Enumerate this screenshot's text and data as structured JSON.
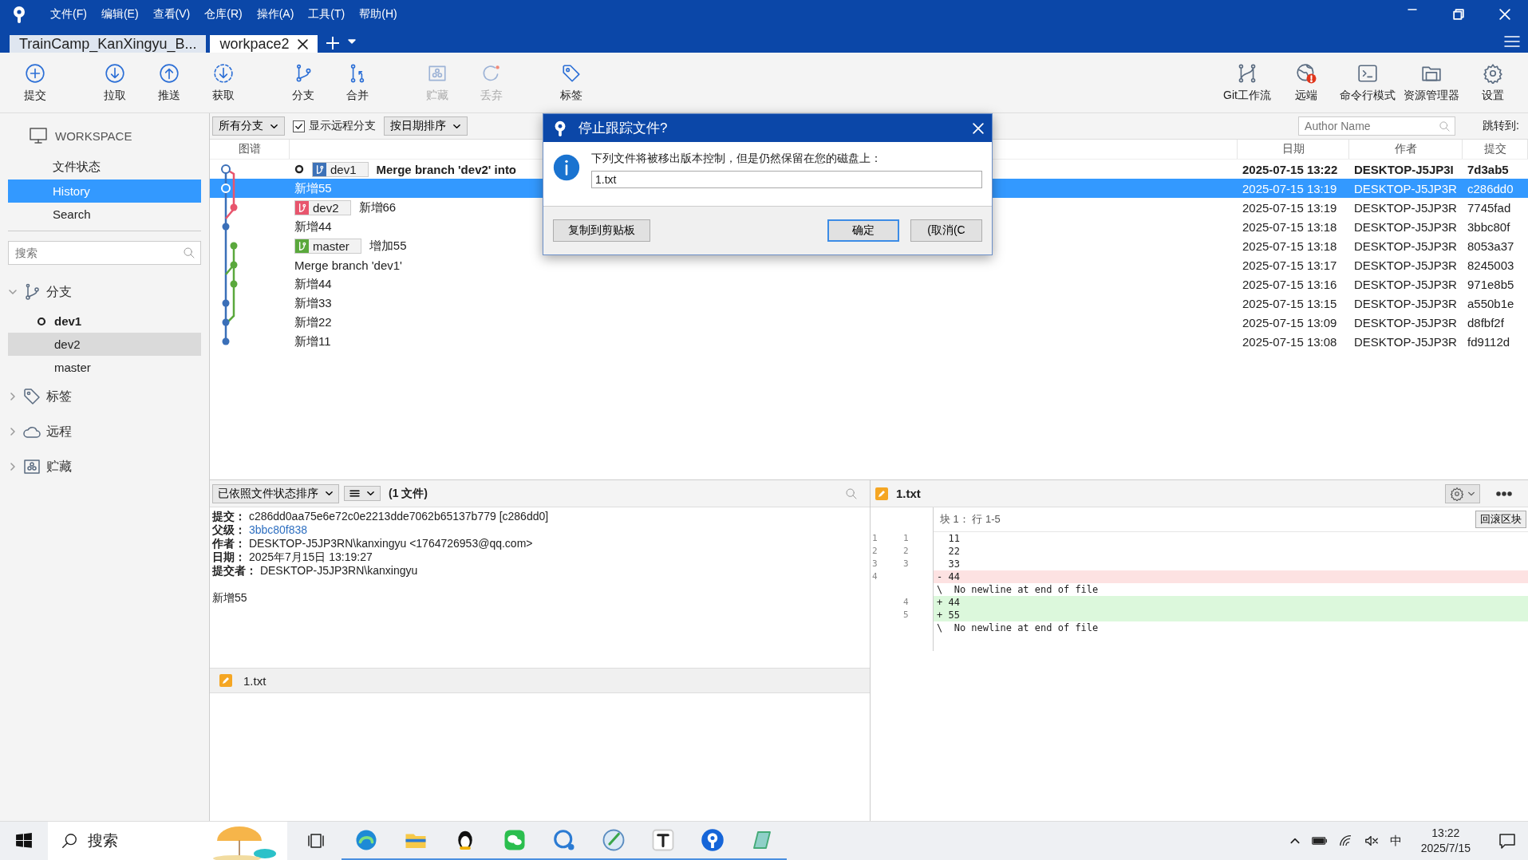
{
  "menu": [
    "文件(F)",
    "编辑(E)",
    "查看(V)",
    "仓库(R)",
    "操作(A)",
    "工具(T)",
    "帮助(H)"
  ],
  "tabs": [
    {
      "label": "TrainCamp_KanXingyu_B...",
      "selected": false
    },
    {
      "label": "workpace2",
      "selected": true
    }
  ],
  "toolbar": {
    "left": [
      {
        "label": "提交",
        "disabled": false
      },
      {
        "label": "拉取",
        "disabled": false
      },
      {
        "label": "推送",
        "disabled": false
      },
      {
        "label": "获取",
        "disabled": false
      },
      {
        "label": "分支",
        "disabled": false
      },
      {
        "label": "合并",
        "disabled": false
      },
      {
        "label": "贮藏",
        "disabled": true
      },
      {
        "label": "丢弃",
        "disabled": true
      },
      {
        "label": "标签",
        "disabled": false
      }
    ],
    "right": [
      {
        "label": "Git工作流",
        "disabled": false
      },
      {
        "label": "远端",
        "disabled": false
      },
      {
        "label": "命令行模式",
        "disabled": false
      },
      {
        "label": "资源管理器",
        "disabled": false
      },
      {
        "label": "设置",
        "disabled": false
      }
    ]
  },
  "sidebar": {
    "workspace": "WORKSPACE",
    "views": [
      {
        "label": "文件状态",
        "selected": false
      },
      {
        "label": "History",
        "selected": true
      },
      {
        "label": "Search",
        "selected": false
      }
    ],
    "search": {
      "placeholder": "搜索"
    },
    "sections": [
      {
        "label": "分支",
        "expanded": true,
        "children": [
          {
            "label": "dev1",
            "current": true,
            "selected": false
          },
          {
            "label": "dev2",
            "current": false,
            "selected": true
          },
          {
            "label": "master",
            "current": false,
            "selected": false
          }
        ]
      },
      {
        "label": "标签",
        "expanded": false
      },
      {
        "label": "远程",
        "expanded": false
      },
      {
        "label": "贮藏",
        "expanded": false
      }
    ]
  },
  "history": {
    "branch_filter": "所有分支",
    "show_remote": {
      "label": "显示远程分支",
      "checked": true
    },
    "sort": "按日期排序",
    "author": {
      "placeholder": "Author Name"
    },
    "jump_label": "跳转到:",
    "columns": [
      "图谱",
      "日期",
      "作者",
      "提交"
    ],
    "rows": [
      {
        "head": true,
        "badge": {
          "label": "dev1",
          "color": "#3d72b8"
        },
        "description": "Merge branch 'dev2' into",
        "date": "2025-07-15 13:22",
        "author": "DESKTOP-J5JP3I",
        "commit": "7d3ab5",
        "bold": true,
        "selected": false
      },
      {
        "head": false,
        "description": "新增55",
        "date": "2025-07-15 13:19",
        "author": "DESKTOP-J5JP3R",
        "commit": "c286dd0",
        "bold": false,
        "selected": true
      },
      {
        "head": false,
        "badge": {
          "label": "dev2",
          "color": "#e8556d"
        },
        "description": "新增66",
        "date": "2025-07-15 13:19",
        "author": "DESKTOP-J5JP3R",
        "commit": "7745fad",
        "bold": false,
        "selected": false
      },
      {
        "head": false,
        "description": "新增44",
        "date": "2025-07-15 13:18",
        "author": "DESKTOP-J5JP3R",
        "commit": "3bbc80f",
        "bold": false,
        "selected": false
      },
      {
        "head": false,
        "badge": {
          "label": "master",
          "color": "#5aa83c"
        },
        "description": "增加55",
        "date": "2025-07-15 13:18",
        "author": "DESKTOP-J5JP3R",
        "commit": "8053a37",
        "bold": false,
        "selected": false
      },
      {
        "head": false,
        "description": "Merge branch 'dev1'",
        "date": "2025-07-15 13:17",
        "author": "DESKTOP-J5JP3R",
        "commit": "8245003",
        "bold": false,
        "selected": false
      },
      {
        "head": false,
        "description": "新增44",
        "date": "2025-07-15 13:16",
        "author": "DESKTOP-J5JP3R",
        "commit": "971e8b5",
        "bold": false,
        "selected": false
      },
      {
        "head": false,
        "description": "新增33",
        "date": "2025-07-15 13:15",
        "author": "DESKTOP-J5JP3R",
        "commit": "a550b1e",
        "bold": false,
        "selected": false
      },
      {
        "head": false,
        "description": "新增22",
        "date": "2025-07-15 13:09",
        "author": "DESKTOP-J5JP3R",
        "commit": "d8fbf2f",
        "bold": false,
        "selected": false
      },
      {
        "head": false,
        "description": "新增11",
        "date": "2025-07-15 13:08",
        "author": "DESKTOP-J5JP3R",
        "commit": "fd9112d",
        "bold": false,
        "selected": false
      }
    ]
  },
  "details": {
    "sort": "已依照文件状态排序",
    "count": "(1 文件)",
    "fields": [
      {
        "label": "提交：",
        "value": "c286dd0aa75e6e72c0e2213dde7062b65137b779 [c286dd0]",
        "kind": "text"
      },
      {
        "label": "父级：",
        "value": "3bbc80f838",
        "kind": "link"
      },
      {
        "label": "作者：",
        "value": "DESKTOP-J5JP3RN\\kanxingyu <1764726953@qq.com>",
        "kind": "text"
      },
      {
        "label": "日期：",
        "value": "2025年7月15日 13:19:27",
        "kind": "text"
      },
      {
        "label": "提交者：",
        "value": "DESKTOP-J5JP3RN\\kanxingyu",
        "kind": "text"
      }
    ],
    "message": "新增55",
    "files": [
      "1.txt"
    ]
  },
  "diff": {
    "file": "1.txt",
    "hunk": "块 1： 行 1-5",
    "revert": "回滚区块",
    "lines": [
      {
        "old": "1",
        "new": "1",
        "kind": "context",
        "text": "  11"
      },
      {
        "old": "2",
        "new": "2",
        "kind": "context",
        "text": "  22"
      },
      {
        "old": "3",
        "new": "3",
        "kind": "context",
        "text": "  33"
      },
      {
        "old": "4",
        "kind": "removed",
        "text": "- 44"
      },
      {
        "kind": "context",
        "text": "\\  No newline at end of file"
      },
      {
        "new": "4",
        "kind": "added",
        "text": "+ 44"
      },
      {
        "new": "5",
        "kind": "added",
        "text": "+ 55"
      },
      {
        "kind": "context",
        "text": "\\  No newline at end of file"
      }
    ]
  },
  "dialog": {
    "title": "停止跟踪文件?",
    "message": "下列文件将被移出版本控制，但是仍然保留在您的磁盘上：",
    "files": "1.txt",
    "buttons": [
      {
        "label": "复制到剪贴板",
        "default": false
      },
      {
        "label": "确定",
        "default": true
      },
      {
        "label": "(取消(C",
        "default": false
      }
    ]
  },
  "taskbar": {
    "search": "搜索",
    "ime": "中",
    "time": "13:22",
    "date": "2025/7/15"
  }
}
